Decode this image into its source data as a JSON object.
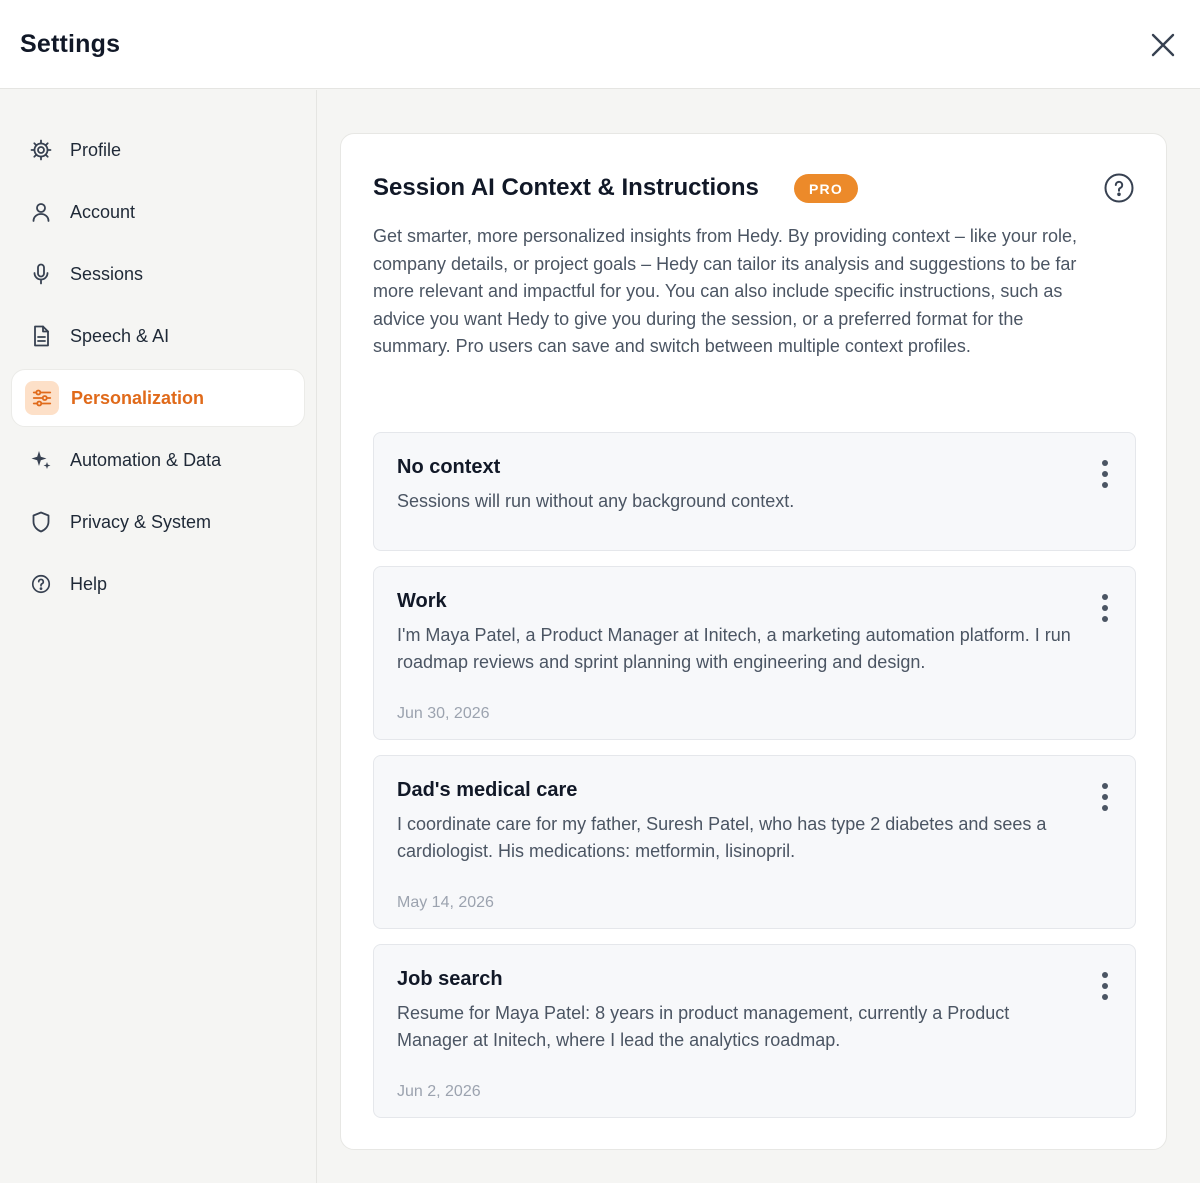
{
  "header": {
    "title": "Settings",
    "close_icon": "close-icon"
  },
  "sidebar": {
    "items": [
      {
        "label": "Profile",
        "icon": "gear-icon"
      },
      {
        "label": "Account",
        "icon": "user-icon"
      },
      {
        "label": "Sessions",
        "icon": "microphone-icon"
      },
      {
        "label": "Speech & AI",
        "icon": "document-icon"
      },
      {
        "label": "Personalization",
        "icon": "sliders-icon",
        "active": true
      },
      {
        "label": "Automation & Data",
        "icon": "sparkle-icon"
      },
      {
        "label": "Privacy & System",
        "icon": "shield-icon"
      },
      {
        "label": "Help",
        "icon": "help-icon"
      }
    ]
  },
  "main": {
    "title": "Session AI Context & Instructions",
    "badge": "PRO",
    "description": "Get smarter, more personalized insights from Hedy. By providing context – like your role, company details, or project goals – Hedy can tailor its analysis and suggestions to be far more relevant and impactful for you. You can also include specific instructions, such as advice you want Hedy to give you during the session, or a preferred format for the summary. Pro users can save and switch between multiple context profiles.",
    "contexts": [
      {
        "title": "No context",
        "body": "Sessions will run without any background context.",
        "date": ""
      },
      {
        "title": "Work",
        "body": "I'm Maya Patel, a Product Manager at Initech, a marketing automation platform. I run roadmap reviews and sprint planning with engineering and design.",
        "date": "Jun 30, 2026"
      },
      {
        "title": "Dad's medical care",
        "body": "I coordinate care for my father, Suresh Patel, who has type 2 diabetes and sees a cardiologist. His medications: metformin, lisinopril.",
        "date": "May 14, 2026"
      },
      {
        "title": "Job search",
        "body": "Resume for Maya Patel: 8 years in product management, currently a Product Manager at Initech, where I lead the analytics roadmap.",
        "date": "Jun 2, 2026"
      }
    ]
  },
  "colors": {
    "accent": "#e06a1a",
    "badge": "#ec8a2a",
    "active_icon_bg": "#fde0c8"
  }
}
